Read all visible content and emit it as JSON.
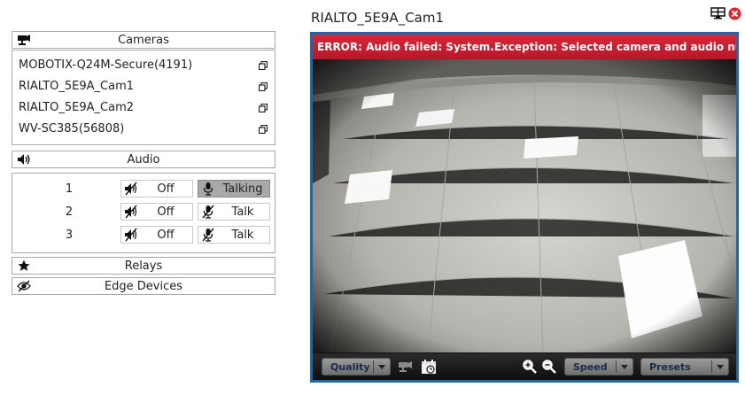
{
  "cameras_panel": {
    "title": "Cameras",
    "items": [
      {
        "label": "MOBOTIX-Q24M-Secure(4191)"
      },
      {
        "label": "RIALTO_5E9A_Cam1"
      },
      {
        "label": "RIALTO_5E9A_Cam2"
      },
      {
        "label": "WV-SC385(56808)"
      }
    ]
  },
  "audio_panel": {
    "title": "Audio",
    "rows": [
      {
        "number": "1",
        "off_label": "Off",
        "talk_label": "Talking",
        "talking": true
      },
      {
        "number": "2",
        "off_label": "Off",
        "talk_label": "Talk",
        "talking": false
      },
      {
        "number": "3",
        "off_label": "Off",
        "talk_label": "Talk",
        "talking": false
      }
    ]
  },
  "relays_panel": {
    "title": "Relays"
  },
  "edge_panel": {
    "title": "Edge Devices"
  },
  "viewer": {
    "camera_title": "RIALTO_5E9A_Cam1",
    "error_message": "ERROR: Audio failed: System.Exception: Selected camera and audio numbers do not match",
    "toolbar": {
      "quality_label": "Quality",
      "speed_label": "Speed",
      "presets_label": "Presets"
    }
  },
  "icons": {
    "cameras": "camera-icon",
    "audio": "speaker-icon",
    "relays": "star-icon",
    "edge": "edge-device-icon",
    "external": "popout-icon",
    "muted": "speaker-muted-icon",
    "mic": "microphone-icon",
    "layout": "layout-grid-icon",
    "close": "close-icon",
    "zoom_in": "zoom-in-icon",
    "zoom_out": "zoom-out-icon",
    "timeline": "timeline-icon"
  },
  "colors": {
    "error_red": "#c41e32",
    "viewer_border": "#1b6aa7",
    "talking_active": "#a8a8a8"
  }
}
